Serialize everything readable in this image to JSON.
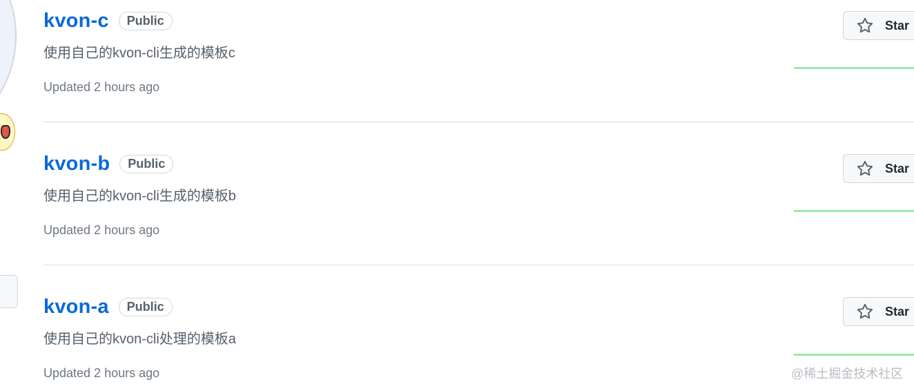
{
  "repos": [
    {
      "name": "kvon-c",
      "visibility": "Public",
      "description": "使用自己的kvon-cli生成的模板c",
      "updated": "Updated 2 hours ago",
      "star_label": "Star"
    },
    {
      "name": "kvon-b",
      "visibility": "Public",
      "description": "使用自己的kvon-cli生成的模板b",
      "updated": "Updated 2 hours ago",
      "star_label": "Star"
    },
    {
      "name": "kvon-a",
      "visibility": "Public",
      "description": "使用自己的kvon-cli处理的模板a",
      "updated": "Updated 2 hours ago",
      "star_label": "Star"
    }
  ],
  "watermark": "@稀土掘金技术社区",
  "colors": {
    "link": "#0969da",
    "muted": "#57606a",
    "border": "#d0d7de",
    "activity": "#9be9a8"
  },
  "icons": {
    "star_button": "star-outline-icon",
    "status": "emoji-status-icon"
  }
}
